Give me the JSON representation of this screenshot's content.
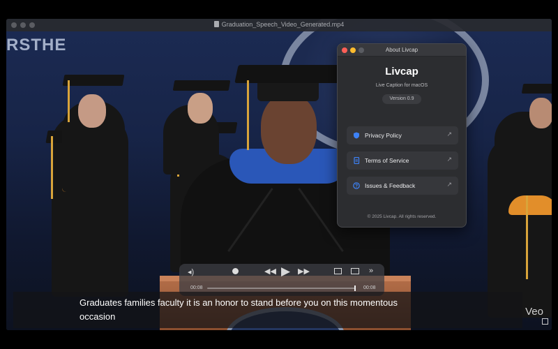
{
  "player": {
    "file_title": "Graduation_Speech_Video_Generated.mp4",
    "banner_text": "RSTHE",
    "time_elapsed": "00:08",
    "time_total": "00:08",
    "progress": 1.0
  },
  "subtitle": {
    "text": "Graduates families faculty it is an honor to stand before you on this momentous occasion"
  },
  "watermark": "Veo",
  "about": {
    "window_title": "About Livcap",
    "app_name": "Livcap",
    "tagline": "Live Caption for macOS",
    "version": "Version 0.9",
    "links": [
      {
        "label": "Privacy Policy",
        "icon": "shield-icon"
      },
      {
        "label": "Terms of Service",
        "icon": "document-icon"
      },
      {
        "label": "Issues & Feedback",
        "icon": "help-circle-icon"
      }
    ],
    "copyright": "© 2025 Livcap. All rights reserved.",
    "colors": {
      "close": "#ff5f57",
      "minimize": "#febc2e",
      "zoom": "#5a5c62",
      "link_icon": "#3d82f7"
    }
  }
}
